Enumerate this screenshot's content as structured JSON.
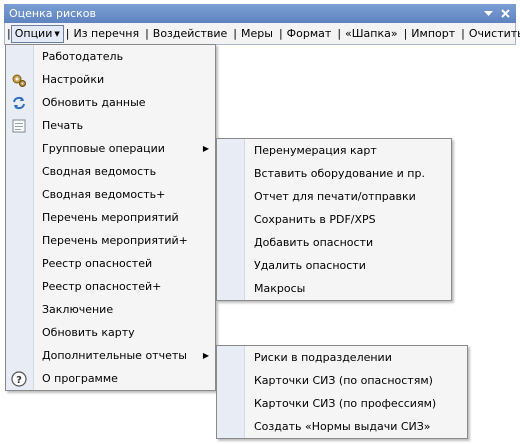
{
  "window": {
    "title": "Оценка рисков"
  },
  "toolbar": {
    "items": [
      {
        "label": "Опции"
      },
      {
        "label": "Из перечня"
      },
      {
        "label": "Воздействие"
      },
      {
        "label": "Меры"
      },
      {
        "label": "Формат"
      },
      {
        "label": "«Шапка»"
      },
      {
        "label": "Импорт"
      },
      {
        "label": "Очистить"
      }
    ]
  },
  "menu": {
    "items": [
      {
        "label": "Работодатель",
        "icon": ""
      },
      {
        "label": "Настройки",
        "icon": "gear-icon"
      },
      {
        "label": "Обновить данные",
        "icon": "refresh-icon"
      },
      {
        "label": "Печать",
        "icon": "print-icon"
      },
      {
        "label": "Групповые операции",
        "icon": "",
        "submenu": true
      },
      {
        "label": "Сводная ведомость",
        "icon": ""
      },
      {
        "label": "Сводная ведомость+",
        "icon": ""
      },
      {
        "label": "Перечень мероприятий",
        "icon": ""
      },
      {
        "label": "Перечень мероприятий+",
        "icon": ""
      },
      {
        "label": "Реестр опасностей",
        "icon": ""
      },
      {
        "label": "Реестр опасностей+",
        "icon": ""
      },
      {
        "label": "Заключение",
        "icon": ""
      },
      {
        "label": "Обновить карту",
        "icon": ""
      },
      {
        "label": "Дополнительные отчеты",
        "icon": "",
        "submenu": true
      },
      {
        "label": "О программе",
        "icon": "help-icon"
      }
    ]
  },
  "submenu_group": {
    "items": [
      {
        "label": "Перенумерация карт"
      },
      {
        "label": "Вставить оборудование и пр."
      },
      {
        "label": "Отчет для печати/отправки"
      },
      {
        "label": "Сохранить в PDF/XPS"
      },
      {
        "label": "Добавить опасности"
      },
      {
        "label": "Удалить опасности"
      },
      {
        "label": "Макросы"
      }
    ]
  },
  "submenu_reports": {
    "items": [
      {
        "label": "Риски в подразделении"
      },
      {
        "label": "Карточки СИЗ (по опасностям)"
      },
      {
        "label": "Карточки СИЗ (по профессиям)"
      },
      {
        "label": "Создать «Нормы выдачи СИЗ»"
      }
    ]
  }
}
